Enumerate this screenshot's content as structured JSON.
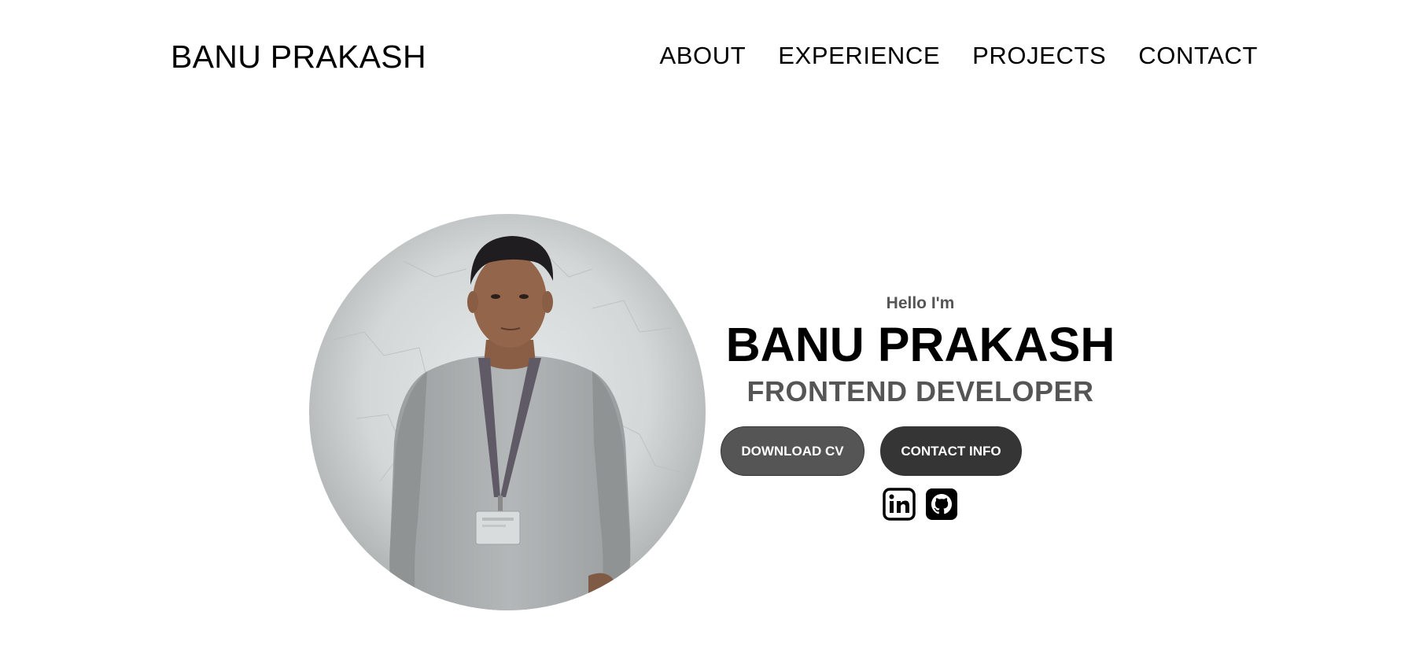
{
  "nav": {
    "logo": "BANU PRAKASH",
    "links": [
      {
        "label": "ABOUT"
      },
      {
        "label": "EXPERIENCE"
      },
      {
        "label": "PROJECTS"
      },
      {
        "label": "CONTACT"
      }
    ]
  },
  "profile": {
    "intro": "Hello I'm",
    "name": "BANU PRAKASH",
    "role": "FRONTEND DEVELOPER",
    "buttons": {
      "download_cv": "DOWNLOAD CV",
      "contact_info": "CONTACT INFO"
    },
    "socials": [
      {
        "icon": "linkedin-icon"
      },
      {
        "icon": "github-icon"
      }
    ]
  }
}
